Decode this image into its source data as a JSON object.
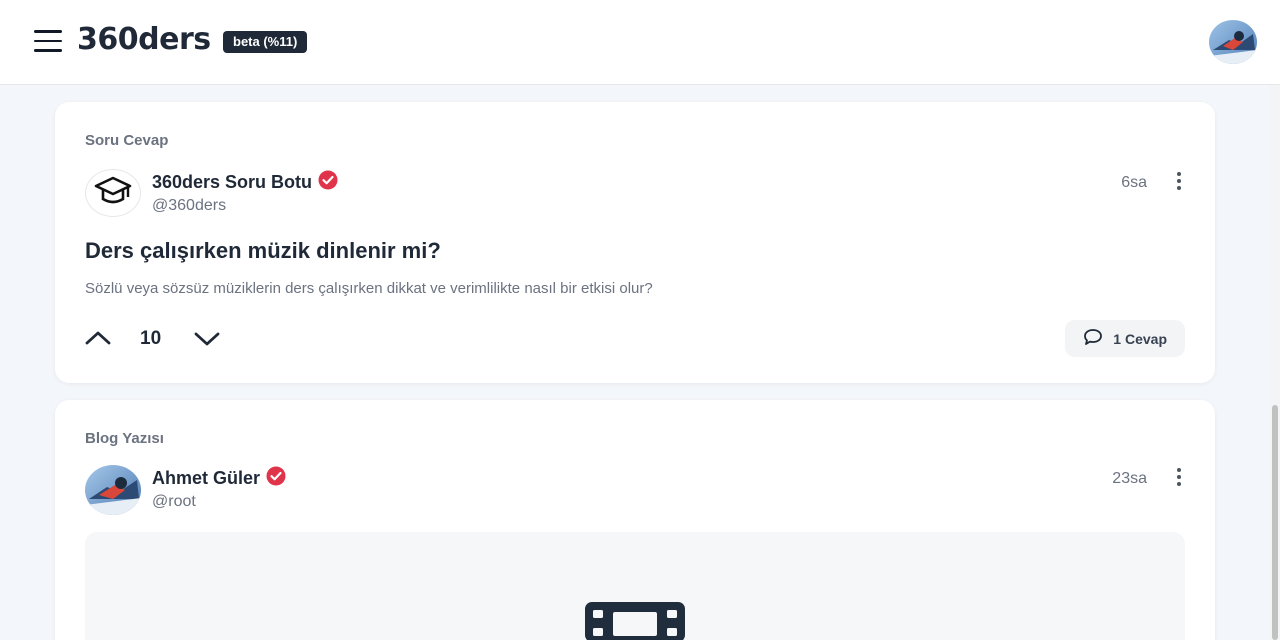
{
  "header": {
    "brand": "360ders",
    "beta_badge": "beta (%11)"
  },
  "icons": {
    "menu": "hamburger-icon",
    "verified": "verified-check-icon",
    "more": "kebab-menu-icon",
    "vote_up": "chevron-up-icon",
    "vote_down": "chevron-down-icon",
    "comment": "speech-bubble-icon",
    "graduation": "graduation-cap-icon",
    "media": "film-icon"
  },
  "colors": {
    "verified": "#e0344b",
    "text_primary": "#1f2937",
    "text_muted": "#6b7280"
  },
  "feed": [
    {
      "type_label": "Soru Cevap",
      "author": "360ders Soru Botu",
      "handle": "@360ders",
      "time": "6sa",
      "title": "Ders çalışırken müzik dinlenir mi?",
      "description": "Sözlü veya sözsüz müziklerin ders çalışırken dikkat ve verimlilikte nasıl bir etkisi olur?",
      "votes": "10",
      "answers_label": "1 Cevap"
    },
    {
      "type_label": "Blog Yazısı",
      "author": "Ahmet Güler",
      "handle": "@root",
      "time": "23sa"
    }
  ]
}
